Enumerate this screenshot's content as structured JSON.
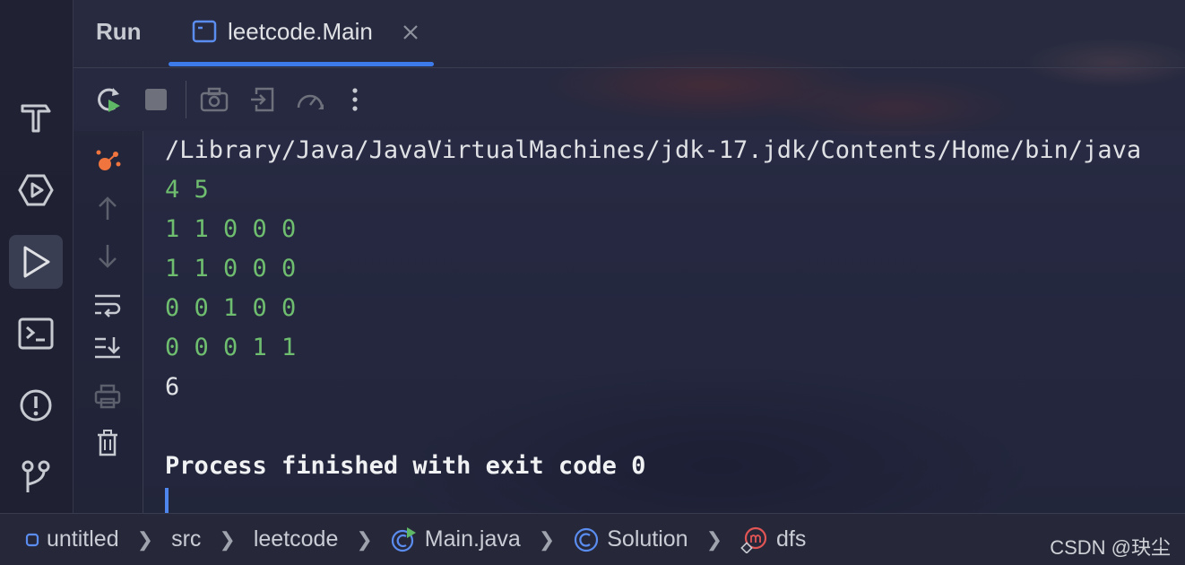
{
  "header": {
    "run_label": "Run",
    "tab_label": "leetcode.Main",
    "accent_color": "#3d7bea"
  },
  "toolbar": {
    "buttons": [
      "rerun-icon",
      "stop-icon",
      "screenshot-icon",
      "restore-layout-icon",
      "profiler-icon",
      "more-icon"
    ]
  },
  "left_strip": {
    "items": [
      "build-hammer-icon",
      "services-icon",
      "run-icon",
      "terminal-icon",
      "problems-icon",
      "git-icon"
    ],
    "active": "run-icon"
  },
  "console": {
    "command": "/Library/Java/JavaVirtualMachines/jdk-17.jdk/Contents/Home/bin/java",
    "input_lines": [
      "4 5",
      "1 1 0 0 0",
      "1 1 0 0 0",
      "0 0 1 0 0",
      "0 0 0 1 1"
    ],
    "output_lines": [
      "6"
    ],
    "finish_message": "Process finished with exit code 0"
  },
  "breadcrumb": {
    "items": [
      "untitled",
      "src",
      "leetcode",
      "Main.java",
      "Solution",
      "dfs"
    ]
  },
  "watermark": "CSDN @玦尘"
}
